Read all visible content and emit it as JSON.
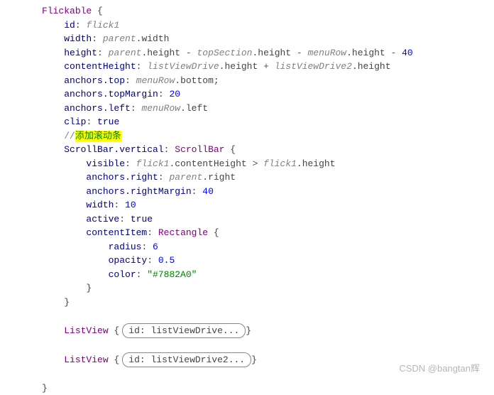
{
  "code": {
    "flickable": "Flickable",
    "scrollbar": "ScrollBar",
    "rectangle": "Rectangle",
    "listview": "ListView",
    "props": {
      "id": "id",
      "width": "width",
      "height": "height",
      "contentHeight": "contentHeight",
      "anchors_top": "anchors.top",
      "anchors_topMargin": "anchors.topMargin",
      "anchors_left": "anchors.left",
      "clip": "clip",
      "scrollbar_vertical": "ScrollBar.vertical",
      "visible": "visible",
      "anchors_right": "anchors.right",
      "anchors_rightMargin": "anchors.rightMargin",
      "active": "active",
      "contentItem": "contentItem",
      "radius": "radius",
      "opacity": "opacity",
      "color": "color"
    },
    "refs": {
      "flick1": "flick1",
      "parent": "parent",
      "topSection": "topSection",
      "menuRow": "menuRow",
      "listViewDrive": "listViewDrive",
      "listViewDrive2": "listViewDrive2"
    },
    "values": {
      "true": "true",
      "n20": "20",
      "n40": "40",
      "n10": "10",
      "n6": "6",
      "n05": "0.5",
      "colorstr": "\"#7882A0\""
    },
    "dot_width": ".width",
    "dot_height": ".height",
    "dot_bottom": ".bottom",
    "dot_left": ".left",
    "dot_right": ".right",
    "dot_contentHeight": ".contentHeight",
    "comment_slashes": "//",
    "comment_text": "添加滚动条",
    "listview1_pill": "id: listViewDrive...",
    "listview2_pill": "id: listViewDrive2...",
    "brace_open": "{",
    "brace_close": "}",
    "colon": ": ",
    "minus": " - ",
    "plus": " + ",
    "gt": " > ",
    "semi": ";"
  },
  "watermark": "CSDN @bangtan辉"
}
